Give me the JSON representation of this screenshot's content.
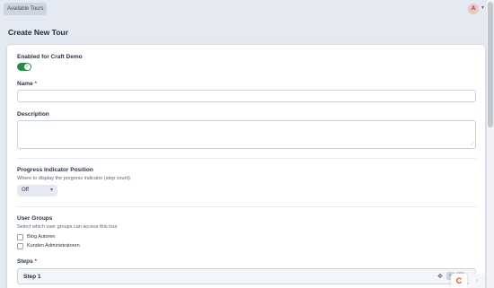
{
  "header": {
    "tours_button": "Available Tours",
    "avatar_initial": "A"
  },
  "page": {
    "title": "Create New Tour"
  },
  "form": {
    "enabled": {
      "label": "Enabled for Craft Demo",
      "value": "on"
    },
    "name": {
      "label": "Name",
      "required_mark": "*",
      "value": ""
    },
    "description": {
      "label": "Description",
      "value": ""
    },
    "progress": {
      "label": "Progress Indicator Position",
      "instructions": "Where to display the progress indicator (step count)",
      "selected": "Off"
    },
    "user_groups": {
      "label": "User Groups",
      "instructions": "Select which user groups can access this tour",
      "options": [
        "Blog Autoren",
        "Kunden Administratoren"
      ]
    },
    "steps": {
      "label": "Steps",
      "required_mark": "*",
      "blocks": [
        {
          "title": "Step 1"
        }
      ]
    }
  },
  "colors": {
    "toggle_on": "#2a8a4a",
    "required": "#d0343c",
    "craft_brand": "#e5422b"
  },
  "icons": {
    "toggle_check": "check-icon",
    "avatar_menu": "chevron-down-icon",
    "select": "chevron-down-icon",
    "block_move": "move-icon",
    "block_collapse": "collapse-icon",
    "craft_logo": "craft-logo-icon"
  }
}
